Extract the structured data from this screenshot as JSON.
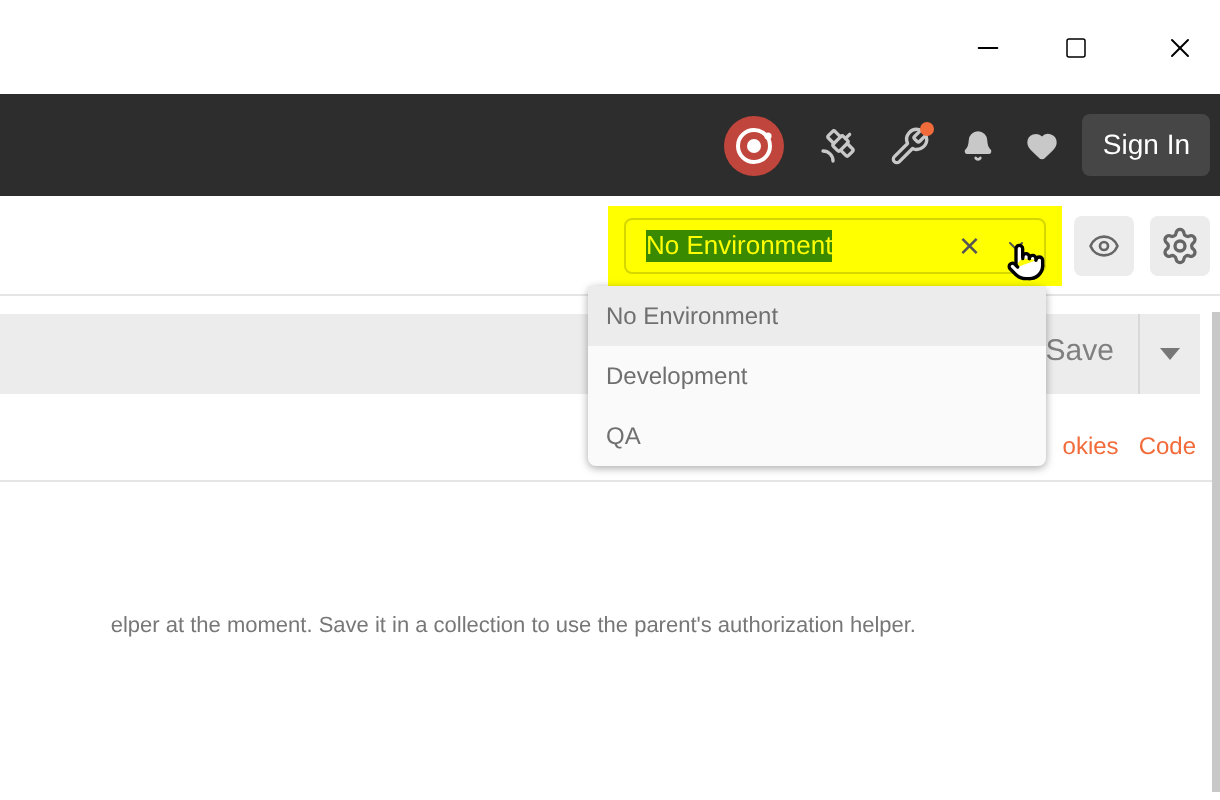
{
  "header": {
    "sign_in": "Sign In",
    "notification_badge": true
  },
  "environment": {
    "value": "No Environment",
    "clear": "×",
    "options": [
      {
        "label": "No Environment",
        "selected": true
      },
      {
        "label": "Development",
        "selected": false
      },
      {
        "label": "QA",
        "selected": false
      }
    ]
  },
  "request": {
    "save": "Save",
    "links": [
      "okies",
      "Code"
    ]
  },
  "auth_message": "elper at the moment. Save it in a collection to use the parent's authorization helper."
}
